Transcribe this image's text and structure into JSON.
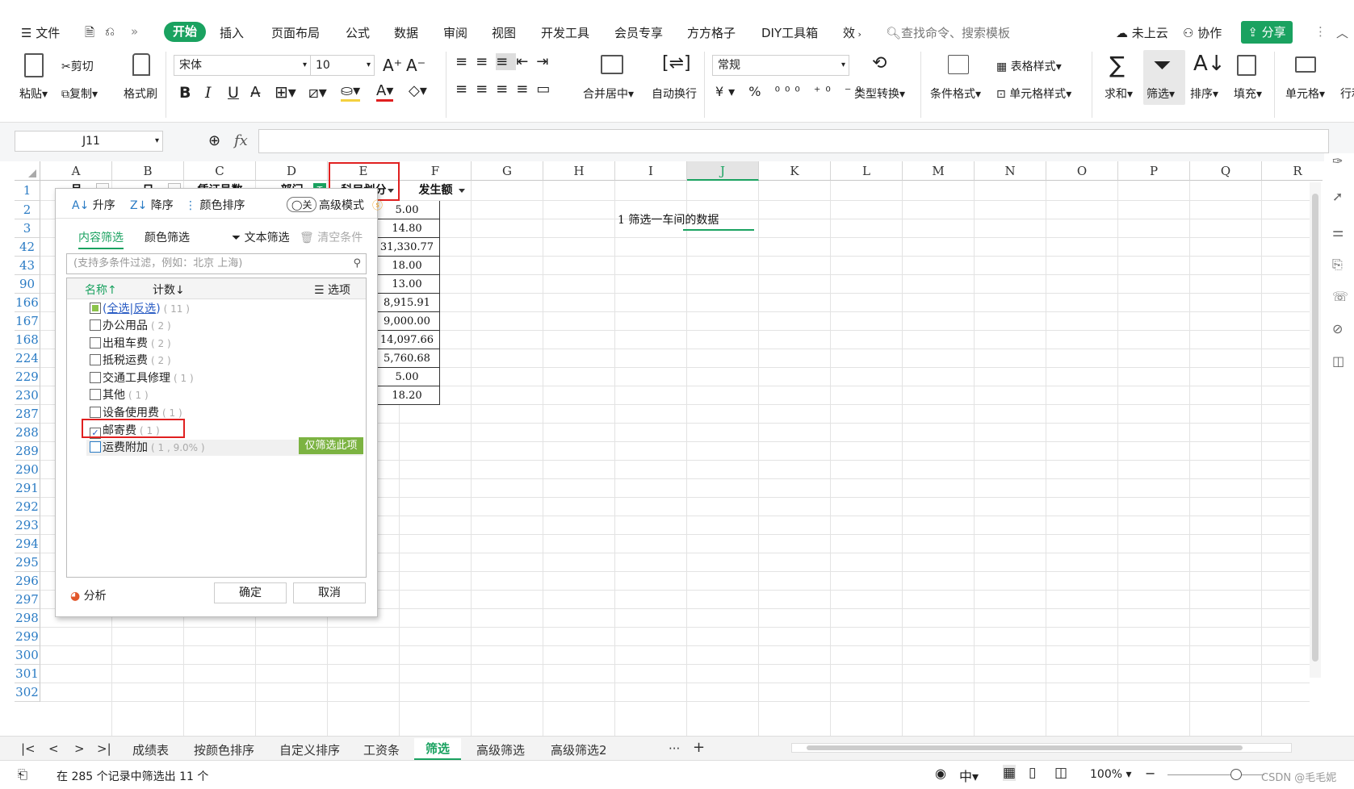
{
  "menu": {
    "items": [
      "文件",
      "开始",
      "插入",
      "页面布局",
      "公式",
      "数据",
      "审阅",
      "视图",
      "开发工具",
      "会员专享",
      "方方格子",
      "DIY工具箱",
      "效"
    ],
    "search_placeholder": "查找命令、搜索模板",
    "cloud": "未上云",
    "collab": "协作",
    "share": "分享"
  },
  "ribbon": {
    "paste": "粘贴",
    "cut": "剪切",
    "copy": "复制",
    "format_painter": "格式刷",
    "font_name": "宋体",
    "font_size": "10",
    "merge_center": "合并居中",
    "wrap": "自动换行",
    "number_format": "常规",
    "type_convert": "类型转换",
    "cond_format": "条件格式",
    "table_style": "表格样式",
    "cell_style": "单元格样式",
    "sum": "求和",
    "filter": "筛选",
    "sort": "排序",
    "fill": "填充",
    "cell": "单元格",
    "row_col": "行和"
  },
  "formula_bar": {
    "name_box": "J11",
    "fx": "fx",
    "content": ""
  },
  "columns": [
    "A",
    "B",
    "C",
    "D",
    "E",
    "F",
    "G",
    "H",
    "I",
    "J",
    "K",
    "L",
    "M",
    "N",
    "O",
    "P",
    "Q",
    "R"
  ],
  "row_numbers": [
    "1",
    "2",
    "3",
    "42",
    "43",
    "90",
    "166",
    "167",
    "168",
    "224",
    "229",
    "230",
    "287",
    "288",
    "289",
    "290",
    "291",
    "292",
    "293",
    "294",
    "295",
    "296",
    "297",
    "298",
    "299",
    "300",
    "301",
    "302"
  ],
  "header_row": [
    "月",
    "日",
    "凭证号数",
    "部门",
    "科目划分",
    "发生额"
  ],
  "f_values": [
    "5.00",
    "14.80",
    "31,330.77",
    "18.00",
    "13.00",
    "8,915.91",
    "9,000.00",
    "14,097.66",
    "5,760.68",
    "5.00",
    "18.20"
  ],
  "note": "1 筛选一车间的数据",
  "filter_panel": {
    "asc": "升序",
    "desc": "降序",
    "color_sort": "颜色排序",
    "toggle": "关",
    "advanced": "高级模式",
    "tab_content": "内容筛选",
    "tab_color": "颜色筛选",
    "text_filter": "文本筛选",
    "clear": "清空条件",
    "search_placeholder": "(支持多条件过滤，例如：北京 上海)",
    "col_name": "名称↑",
    "col_count": "计数↓",
    "options": "选项",
    "select_all": "全选",
    "invert": "反选",
    "all_count": "( 11 )",
    "items": [
      {
        "label": "办公用品",
        "count": "( 2 )",
        "checked": false
      },
      {
        "label": "出租车费",
        "count": "( 2 )",
        "checked": false
      },
      {
        "label": "抵税运费",
        "count": "( 2 )",
        "checked": false
      },
      {
        "label": "交通工具修理",
        "count": "( 1 )",
        "checked": false
      },
      {
        "label": "其他",
        "count": "( 1 )",
        "checked": false
      },
      {
        "label": "设备使用费",
        "count": "( 1 )",
        "checked": false
      },
      {
        "label": "邮寄费",
        "count": "( 1 )",
        "checked": true
      },
      {
        "label": "运费附加",
        "count": "( 1 , 9.0% )",
        "checked": false
      }
    ],
    "only_this": "仅筛选此项",
    "analyze": "分析",
    "ok": "确定",
    "cancel": "取消"
  },
  "sheet_tabs": [
    "成绩表",
    "按颜色排序",
    "自定义排序",
    "工资条",
    "筛选",
    "高级筛选",
    "高级筛选2"
  ],
  "active_tab": "筛选",
  "status_text": "在 285 个记录中筛选出 11 个",
  "zoom": "100%",
  "watermark": "CSDN @毛毛妮",
  "colors": {
    "accent": "#1aa260",
    "filter_green": "#7cb342",
    "red_mark": "#e02020"
  }
}
